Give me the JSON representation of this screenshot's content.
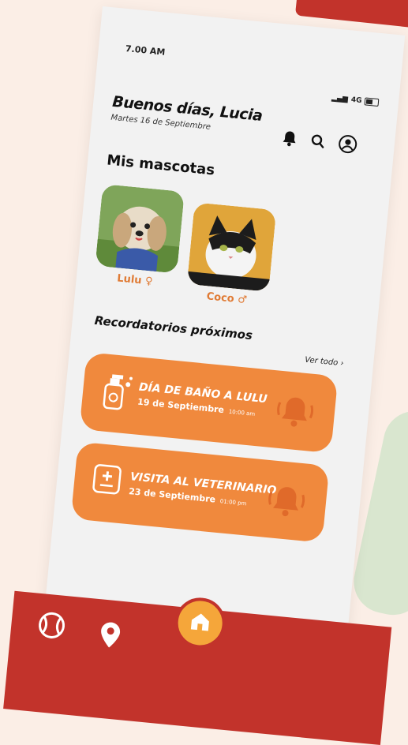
{
  "status_bar": {
    "time": "7.00 AM",
    "network": "4G"
  },
  "header": {
    "greeting": "Buenos días, Lucia",
    "date": "Martes 16 de Septiembre",
    "icons": [
      "bell-icon",
      "search-icon",
      "user-icon"
    ]
  },
  "pets": {
    "title": "Mis mascotas",
    "items": [
      {
        "name": "Lulu",
        "sex_symbol": "♀"
      },
      {
        "name": "Coco",
        "sex_symbol": "♂"
      }
    ]
  },
  "reminders": {
    "title": "Recordatorios próximos",
    "see_all": "Ver todo ›",
    "items": [
      {
        "title": "DÍA DE BAÑO A LULU",
        "date": "19 de Septiembre",
        "time": "10:00 am",
        "icon": "shampoo-icon"
      },
      {
        "title": "VISITA AL VETERINARIO",
        "date": "23 de Septiembre",
        "time": "01:00 pm",
        "icon": "medical-kit-icon"
      }
    ]
  },
  "nav": {
    "items": [
      "ball-icon",
      "location-icon",
      "home-icon"
    ]
  },
  "colors": {
    "accent": "#f0893d",
    "nav": "#c2332b",
    "background": "#f2f2f2",
    "home": "#f5a63a"
  }
}
